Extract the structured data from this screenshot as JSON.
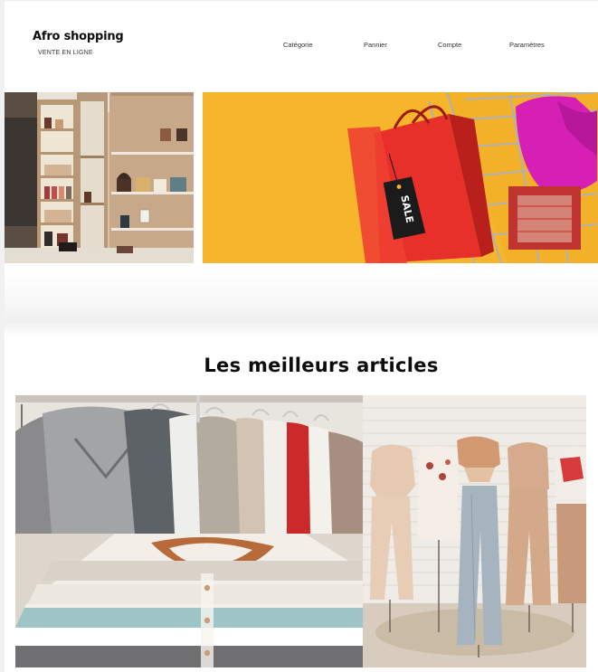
{
  "brand": {
    "title": "Afro shopping",
    "tagline": "VENTE EN LIGNE"
  },
  "nav": {
    "items": [
      {
        "label": "Catégorie"
      },
      {
        "label": "Pannier"
      },
      {
        "label": "Compte"
      },
      {
        "label": "Paramètres"
      }
    ]
  },
  "hero": {
    "right_tag_text": "SALE"
  },
  "best": {
    "title": "Les meilleurs articles"
  },
  "colors": {
    "hero_yellow": "#f6b52a",
    "bag_red": "#e8302b",
    "garment_magenta": "#d61fb5",
    "text": "#0c0c0c"
  }
}
